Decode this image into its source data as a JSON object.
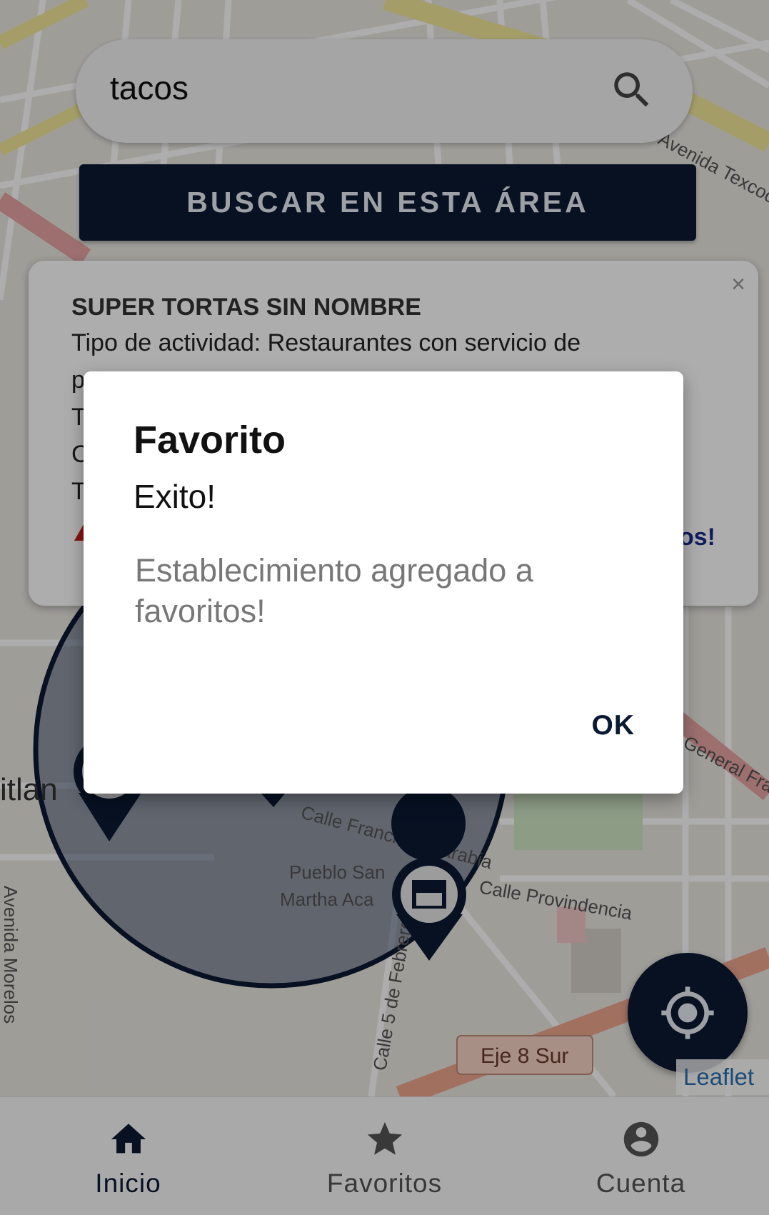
{
  "search": {
    "value": "tacos",
    "icon": "search-icon"
  },
  "area_button": {
    "label": "BUSCAR EN ESTA ÁREA"
  },
  "popup": {
    "title": "SUPER TORTAS SIN NOMBRE",
    "line1": "Tipo de actividad: Restaurantes con servicio de",
    "line2": "p",
    "line3": "T",
    "line4": "C",
    "line5": "T",
    "favorite_link_partial": "os!",
    "close": "×"
  },
  "map": {
    "streets": [
      "Calle Francisco Sarabia",
      "Calle Provindencia",
      "Calle 5 de Febrero",
      "Eje 8 Sur",
      "Avenida Morelos",
      "Avenida Texcoco",
      "Pueblo San",
      "Martha Aca",
      "itlan",
      "General Franc"
    ],
    "attribution": "Leaflet",
    "accent": "#0b1a33"
  },
  "dialog": {
    "title": "Favorito",
    "subtitle": "Exito!",
    "message": "Establecimiento agregado a favoritos!",
    "ok_label": "OK"
  },
  "bottom_nav": {
    "items": [
      {
        "label": "Inicio",
        "icon": "home-icon",
        "active": true
      },
      {
        "label": "Favoritos",
        "icon": "star-icon",
        "active": false
      },
      {
        "label": "Cuenta",
        "icon": "account-icon",
        "active": false
      }
    ]
  },
  "colors": {
    "primary": "#0b1a33",
    "scrim": "rgba(0,0,0,0.32)",
    "link": "#1a2a8a",
    "warning": "#cc1b1b"
  }
}
